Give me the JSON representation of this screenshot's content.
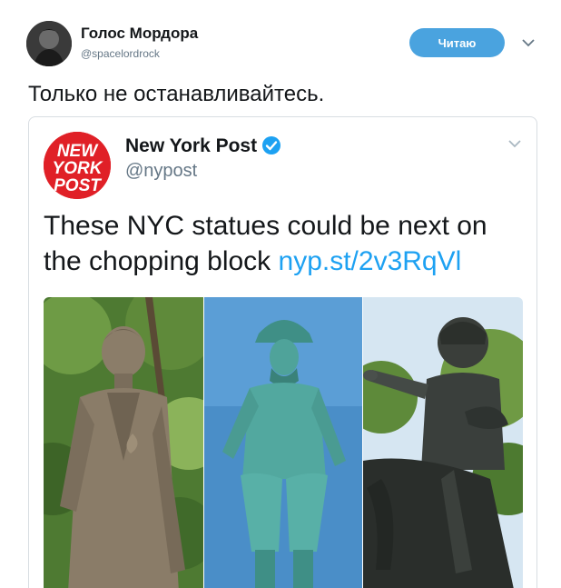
{
  "user": {
    "name": "Голос Мордора",
    "handle": "@spacelordrock",
    "follow_label": "Читаю"
  },
  "tweet": {
    "text": "Только не останавливайтесь."
  },
  "quoted": {
    "logo_text": [
      "NEW",
      "YORK",
      "POST"
    ],
    "name": "New York Post",
    "handle": "@nypost",
    "text": "These NYC statues could be next on the chopping block ",
    "link": "nyp.st/2v3RqVl"
  },
  "colors": {
    "follow_button": "#4aa3df",
    "link": "#1da1f2",
    "verified": "#1da1f2",
    "nyp_red": "#e02027"
  },
  "icons": [
    "chevron-down-icon",
    "verified-badge-icon"
  ]
}
